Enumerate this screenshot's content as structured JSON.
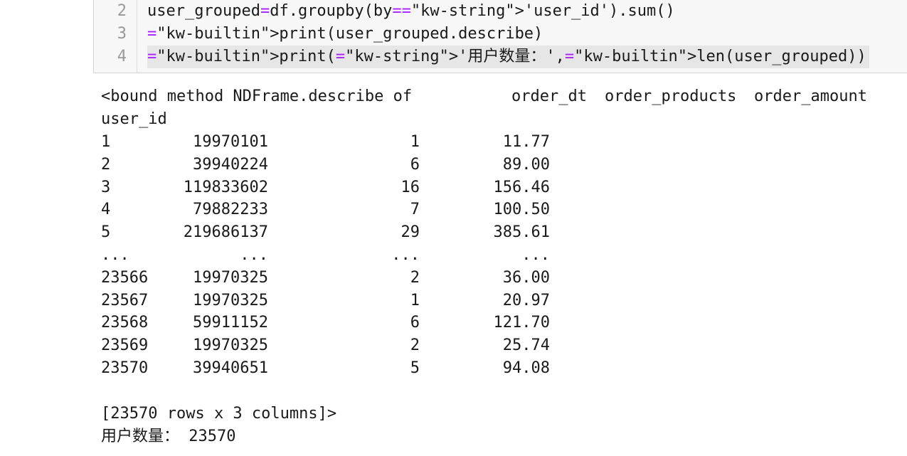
{
  "cell": {
    "lines": [
      {
        "no": "2",
        "text": "user_grouped=df.groupby(by='user_id').sum()"
      },
      {
        "no": "3",
        "text": "print(user_grouped.describe)"
      },
      {
        "no": "4",
        "text": "print('用户数量：',len(user_grouped))"
      }
    ]
  },
  "output": {
    "header_prefix": "<bound method NDFrame.describe of",
    "columns": [
      "order_dt",
      "order_products",
      "order_amount"
    ],
    "index_name": "user_id",
    "rows": [
      {
        "idx": "1",
        "dt": "19970101",
        "prod": "1",
        "amt": "11.77"
      },
      {
        "idx": "2",
        "dt": "39940224",
        "prod": "6",
        "amt": "89.00"
      },
      {
        "idx": "3",
        "dt": "119833602",
        "prod": "16",
        "amt": "156.46"
      },
      {
        "idx": "4",
        "dt": "79882233",
        "prod": "7",
        "amt": "100.50"
      },
      {
        "idx": "5",
        "dt": "219686137",
        "prod": "29",
        "amt": "385.61"
      },
      {
        "idx": "...",
        "dt": "...",
        "prod": "...",
        "amt": "..."
      },
      {
        "idx": "23566",
        "dt": "19970325",
        "prod": "2",
        "amt": "36.00"
      },
      {
        "idx": "23567",
        "dt": "19970325",
        "prod": "1",
        "amt": "20.97"
      },
      {
        "idx": "23568",
        "dt": "59911152",
        "prod": "6",
        "amt": "121.70"
      },
      {
        "idx": "23569",
        "dt": "19970325",
        "prod": "2",
        "amt": "25.74"
      },
      {
        "idx": "23570",
        "dt": "39940651",
        "prod": "5",
        "amt": "94.08"
      }
    ],
    "shape_line": "[23570 rows x 3 columns]>",
    "count_line": "用户数量： 23570"
  }
}
